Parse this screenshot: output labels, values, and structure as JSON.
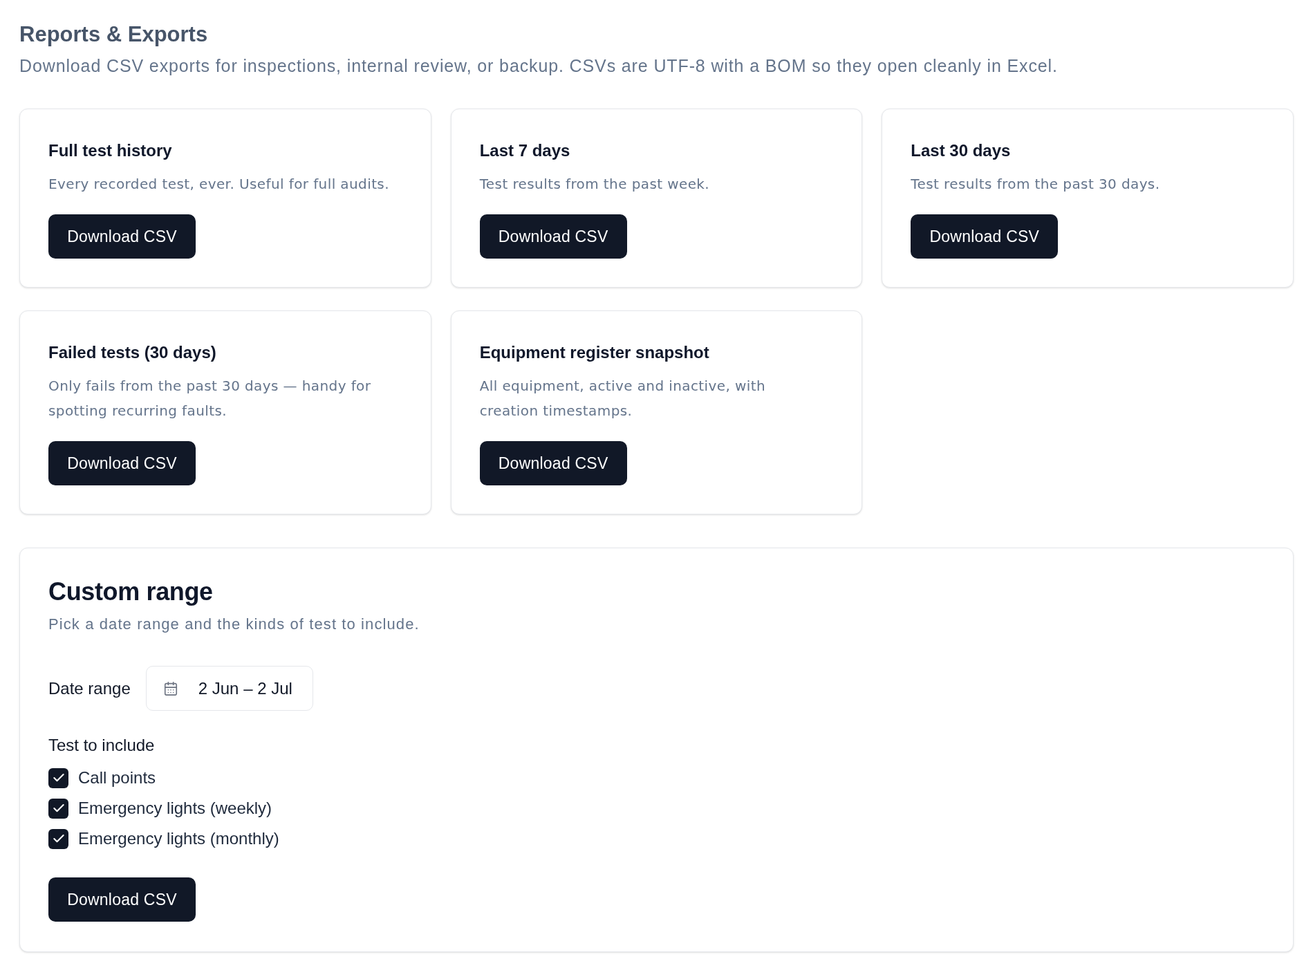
{
  "header": {
    "title": "Reports & Exports",
    "description": "Download CSV exports for inspections, internal review, or backup. CSVs are UTF-8 with a BOM so they open cleanly in Excel."
  },
  "export_cards": [
    {
      "title": "Full test history",
      "description": "Every recorded test, ever. Useful for full audits.",
      "button": "Download CSV"
    },
    {
      "title": "Last 7 days",
      "description": "Test results from the past week.",
      "button": "Download CSV"
    },
    {
      "title": "Last 30 days",
      "description": "Test results from the past 30 days.",
      "button": "Download CSV"
    },
    {
      "title": "Failed tests (30 days)",
      "description": "Only fails from the past 30 days — handy for spotting recurring faults.",
      "button": "Download CSV"
    },
    {
      "title": "Equipment register snapshot",
      "description": "All equipment, active and inactive, with creation timestamps.",
      "button": "Download CSV"
    }
  ],
  "custom_range": {
    "title": "Custom range",
    "description": "Pick a date range and the kinds of test to include.",
    "date_range": {
      "label": "Date range",
      "value": "2 Jun – 2 Jul"
    },
    "tests": {
      "label": "Test to include",
      "options": [
        {
          "label": "Call points",
          "checked": true
        },
        {
          "label": "Emergency lights (weekly)",
          "checked": true
        },
        {
          "label": "Emergency lights (monthly)",
          "checked": true
        }
      ]
    },
    "button": "Download CSV"
  }
}
